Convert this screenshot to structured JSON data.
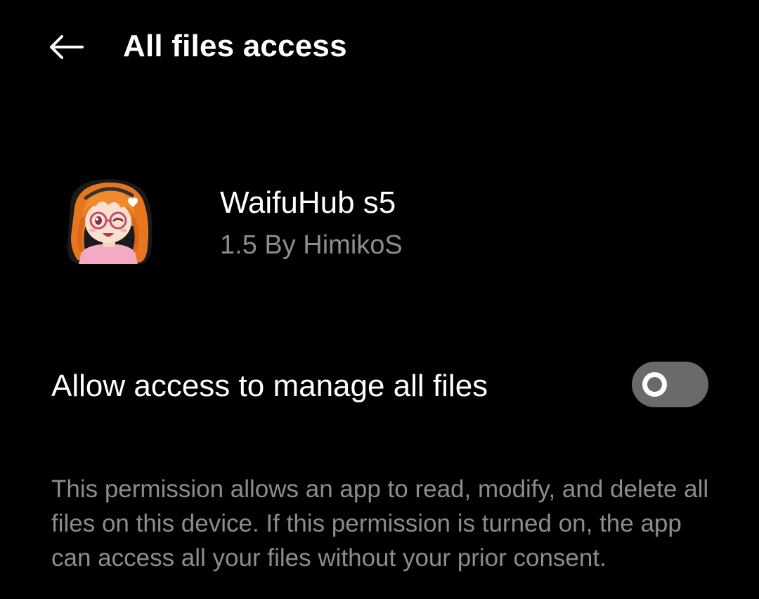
{
  "header": {
    "back_icon": "back-arrow-icon",
    "title": "All files access"
  },
  "app": {
    "icon": "app-avatar-icon",
    "name": "WaifuHub s5",
    "meta": "1.5 By HimikoS"
  },
  "permission": {
    "label": "Allow access to manage all files",
    "toggle_state": "off",
    "description": "This permission allows an app to read, modify, and delete all files on this device. If this permission is turned on, the app can access all your files without your prior consent."
  },
  "colors": {
    "background": "#000000",
    "primary_text": "#ffffff",
    "secondary_text": "#8c8c8c",
    "toggle_track_off": "#6a6a6a",
    "toggle_knob": "#ffffff"
  }
}
